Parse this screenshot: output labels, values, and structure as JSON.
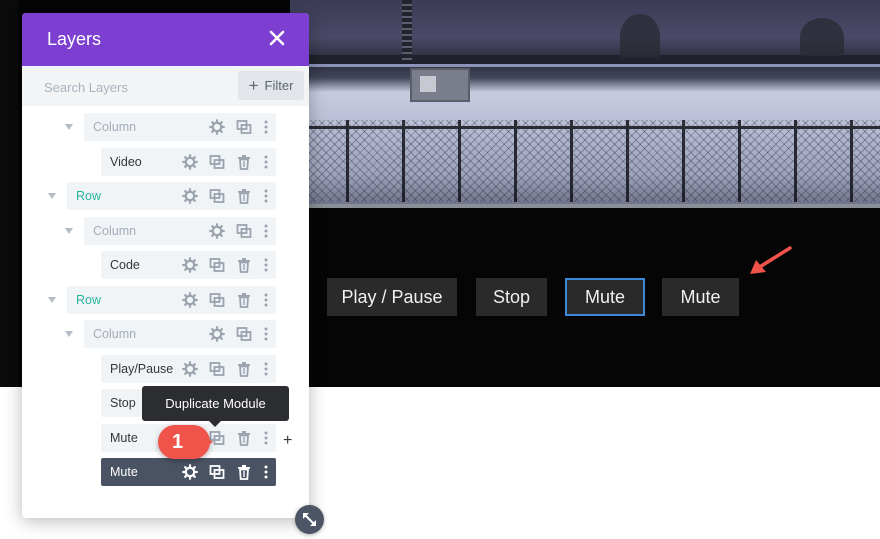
{
  "panel": {
    "title": "Layers",
    "search_placeholder": "Search Layers",
    "filter_label": "Filter",
    "accent": "#7c3fd1"
  },
  "tree": [
    {
      "label": "Column",
      "type": "column"
    },
    {
      "label": "Video",
      "type": "module"
    },
    {
      "label": "Row",
      "type": "row"
    },
    {
      "label": "Column",
      "type": "column"
    },
    {
      "label": "Code",
      "type": "module"
    },
    {
      "label": "Row",
      "type": "row"
    },
    {
      "label": "Column",
      "type": "column"
    },
    {
      "label": "Play/Pause",
      "type": "module"
    },
    {
      "label": "Stop",
      "type": "module"
    },
    {
      "label": "Mute",
      "type": "module"
    },
    {
      "label": "Mute",
      "type": "module",
      "selected": true
    }
  ],
  "tooltip": "Duplicate Module",
  "step_badge": "1",
  "add_symbol": "+",
  "controls": [
    "Play / Pause",
    "Stop",
    "Mute",
    "Mute"
  ],
  "colors": {
    "row_label": "#28b59c",
    "badge": "#ef5349",
    "focus_border": "#3d89d8",
    "selected_row": "#4a5363"
  }
}
